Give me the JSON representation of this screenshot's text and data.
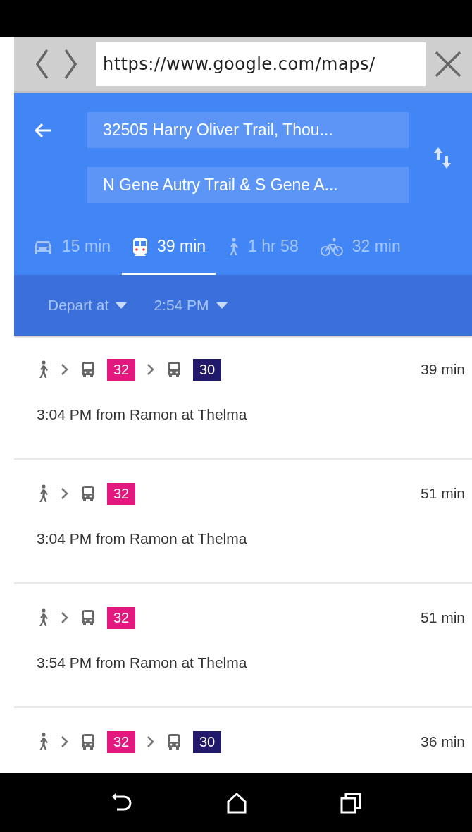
{
  "browser": {
    "url": "https://www.google.com/maps/"
  },
  "directions": {
    "origin": "32505 Harry Oliver Trail, Thou...",
    "destination": "N Gene Autry Trail & S Gene A..."
  },
  "modes": [
    {
      "kind": "car",
      "label": "15 min",
      "selected": false
    },
    {
      "kind": "transit",
      "label": "39 min",
      "selected": true
    },
    {
      "kind": "walk",
      "label": "1 hr 58",
      "selected": false
    },
    {
      "kind": "bike",
      "label": "32 min",
      "selected": false
    }
  ],
  "depart": {
    "mode": "Depart at",
    "time": "2:54 PM"
  },
  "routes": [
    {
      "legs": [
        {
          "kind": "walk"
        },
        {
          "kind": "bus",
          "line": "32",
          "color": "#e2187e"
        },
        {
          "kind": "bus",
          "line": "30",
          "color": "#211a6b"
        }
      ],
      "duration": "39 min",
      "description": "3:04 PM from Ramon at Thelma"
    },
    {
      "legs": [
        {
          "kind": "walk"
        },
        {
          "kind": "bus",
          "line": "32",
          "color": "#e2187e"
        }
      ],
      "duration": "51 min",
      "description": "3:04 PM from Ramon at Thelma"
    },
    {
      "legs": [
        {
          "kind": "walk"
        },
        {
          "kind": "bus",
          "line": "32",
          "color": "#e2187e"
        }
      ],
      "duration": "51 min",
      "description": "3:54 PM from Ramon at Thelma"
    },
    {
      "legs": [
        {
          "kind": "walk"
        },
        {
          "kind": "bus",
          "line": "32",
          "color": "#e2187e"
        },
        {
          "kind": "bus",
          "line": "30",
          "color": "#211a6b"
        }
      ],
      "duration": "36 min"
    }
  ]
}
